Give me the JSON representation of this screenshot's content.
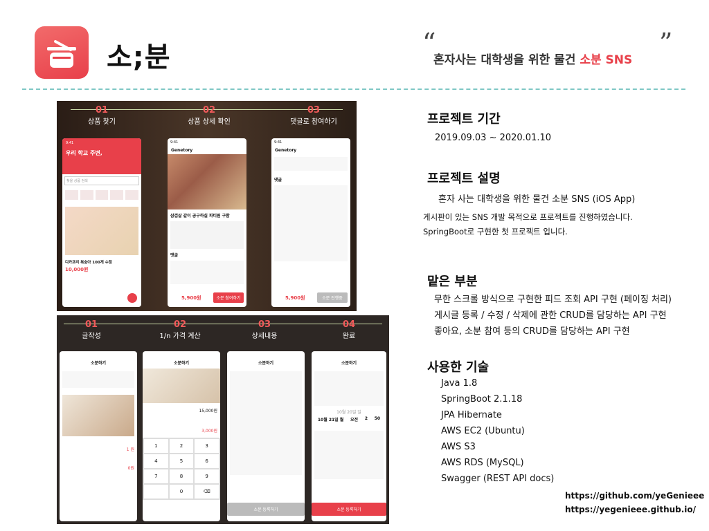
{
  "app": {
    "name": "소;분",
    "quote_open": "“",
    "quote_close": "”",
    "tagline_pre": "혼자사는 대학생을 위한 물건 ",
    "tagline_accent": "소분 SNS"
  },
  "shot1": {
    "steps": [
      {
        "num": "01",
        "label": "상품 찾기"
      },
      {
        "num": "02",
        "label": "상품 상세 확인"
      },
      {
        "num": "03",
        "label": "댓글로 참여하기"
      }
    ],
    "p1": {
      "time": "9:41",
      "heading": "우리 학교 주변,",
      "search": "찾을 상품 검색",
      "item": "디카프리 복숭아 100개 수정",
      "price": "10,000원"
    },
    "p2": {
      "time": "9:41",
      "user": "Genetory",
      "post_title": "삼겹살 같이 공구하실 파티원 구함",
      "reply": "댓글",
      "price": "5,900원",
      "buy": "소분 참여하기"
    },
    "p3": {
      "time": "9:41",
      "user": "Genetory",
      "reply": "댓글",
      "price": "5,900원",
      "buy": "소분 진행중"
    }
  },
  "shot2": {
    "steps": [
      {
        "num": "01",
        "label": "글작성"
      },
      {
        "num": "02",
        "label": "1/n 가격 계산"
      },
      {
        "num": "03",
        "label": "상세내용"
      },
      {
        "num": "04",
        "label": "완료"
      }
    ],
    "q1": {
      "title": "소분하기",
      "price": "1 원",
      "fee": "0원"
    },
    "q2": {
      "title": "소분하기",
      "total": "15,000원",
      "each": "3,000원",
      "keys": [
        "1",
        "2",
        "3",
        "4",
        "5",
        "6",
        "7",
        "8",
        "9",
        "",
        "0",
        "⌫"
      ]
    },
    "q3": {
      "title": "소분하기",
      "submit": "소분 등록하기"
    },
    "q4": {
      "title": "소분하기",
      "date_row1": "10월 20일 일",
      "date_row2": "10월 21일 월",
      "date_ampm": "오전",
      "date_h": "2",
      "date_m": "50",
      "submit": "소분 등록하기"
    }
  },
  "right": {
    "s1_title": "프로젝트 기간",
    "s1_text": "2019.09.03 ~ 2020.01.10",
    "s2_title": "프로젝트 설명",
    "s2_l1": "혼자 사는 대학생을 위한 물건 소분 SNS (iOS App)",
    "s2_l2": "게시판이 있는 SNS 개발 목적으로 프로젝트를 진행하였습니다.",
    "s2_l3": "SpringBoot로 구현한 첫 프로젝트 입니다.",
    "s3_title": "맡은 부분",
    "s3_l1": "무한 스크롤 방식으로 구현한 피드 조회 API 구현 (페이징 처리)",
    "s3_l2": "게시글 등록 / 수정 / 삭제에 관한 CRUD를 담당하는 API 구현",
    "s3_l3": "좋아요, 소분 참여 등의 CRUD를 담당하는 API 구현",
    "s4_title": "사용한 기술",
    "tech": [
      "Java 1.8",
      "SpringBoot 2.1.18",
      "JPA Hibernate",
      "AWS EC2 (Ubuntu)",
      "AWS S3",
      "AWS RDS (MySQL)",
      "Swagger (REST API docs)"
    ],
    "link1": "https://github.com/yeGenieee",
    "link2": "https://yegenieee.github.io/"
  },
  "colors": {
    "accent": "#e8404a",
    "divider": "#7ec7c4"
  }
}
